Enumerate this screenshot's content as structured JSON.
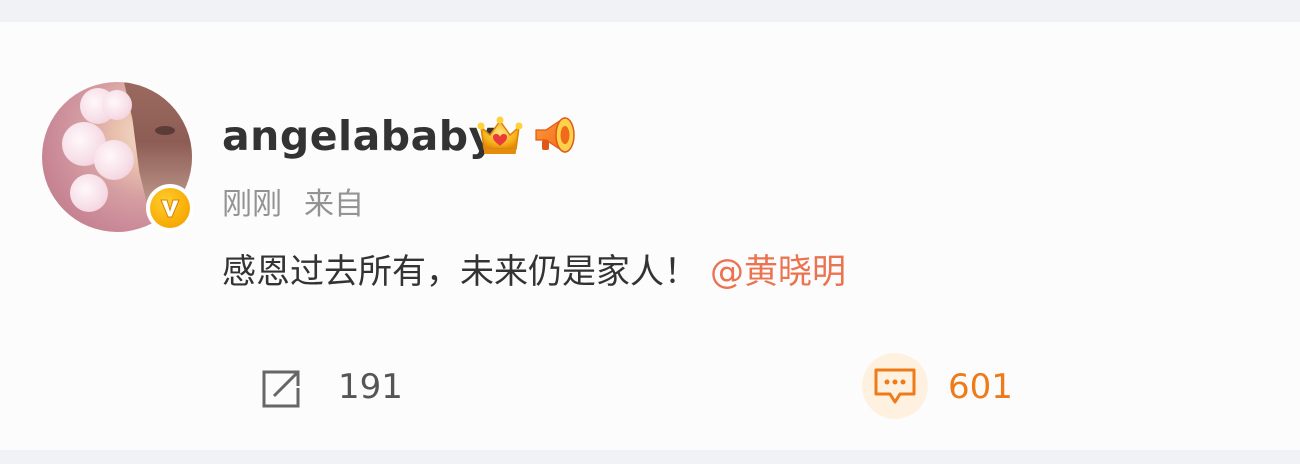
{
  "post": {
    "author": {
      "name": "angelababy",
      "avatar_icon": "avatar",
      "verified_icon": "verified-v-badge-icon",
      "badge_icons": [
        "crown-icon",
        "megaphone-icon"
      ]
    },
    "meta": {
      "time": "刚刚",
      "source": "来自"
    },
    "text": "感恩过去所有，未来仍是家人！",
    "mention": "@黄晓明",
    "actions": {
      "share_count": "191",
      "comment_count": "601"
    }
  },
  "colors": {
    "mention": "#eb7350",
    "comment_accent": "#ee7a1a",
    "verified_badge": "#f7a600",
    "text": "#333333",
    "meta_text": "#939393"
  }
}
